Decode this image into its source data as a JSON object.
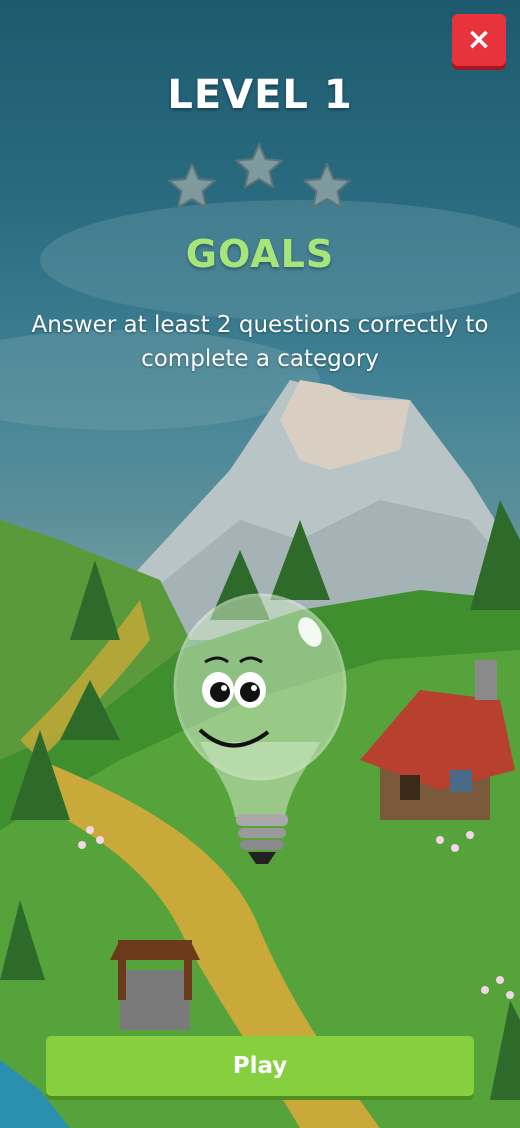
{
  "header": {
    "title": "LEVEL 1",
    "close_icon": "close-icon",
    "close_label": "×"
  },
  "rating": {
    "stars_earned": 0,
    "stars_total": 3,
    "star_color": "#7e9a9e"
  },
  "goals": {
    "heading": "GOALS",
    "description": "Answer at least 2 questions correctly to complete a category"
  },
  "mascot": {
    "icon": "lightbulb-mascot"
  },
  "actions": {
    "play_label": "Play"
  },
  "colors": {
    "close": "#e8333d",
    "play": "#86cf3e",
    "goals": "#a6e57a"
  }
}
